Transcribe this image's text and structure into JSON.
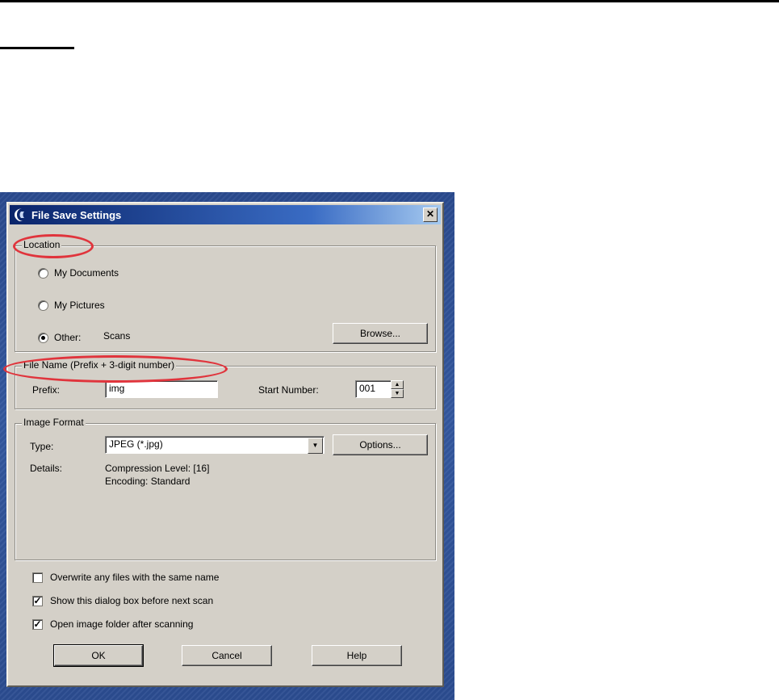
{
  "dialog": {
    "title": "File Save Settings",
    "close_glyph": "✕",
    "icons": [
      "app-icon",
      "close-icon"
    ]
  },
  "location": {
    "legend": "Location",
    "options": [
      {
        "label": "My Documents",
        "selected": false
      },
      {
        "label": "My Pictures",
        "selected": false
      },
      {
        "label": "Other:",
        "selected": true
      }
    ],
    "other_path": "Scans",
    "browse_label": "Browse..."
  },
  "file_name": {
    "legend": "File Name (Prefix + 3-digit number)",
    "prefix_label": "Prefix:",
    "prefix_value": "img",
    "start_label": "Start Number:",
    "start_value": "001"
  },
  "image_format": {
    "legend": "Image Format",
    "type_label": "Type:",
    "type_value": "JPEG (*.jpg)",
    "options_label": "Options...",
    "details_label": "Details:",
    "details_line1": "Compression Level: [16]",
    "details_line2": "Encoding: Standard"
  },
  "checkboxes": [
    {
      "label": "Overwrite any files with the same name",
      "checked": false
    },
    {
      "label": "Show this dialog box before next scan",
      "checked": true
    },
    {
      "label": "Open image folder after scanning",
      "checked": true
    }
  ],
  "buttons": {
    "ok": "OK",
    "cancel": "Cancel",
    "help": "Help"
  },
  "colors": {
    "annotation": "#e0343c",
    "titlebar": "#0a246a",
    "desktop": "#2a4a8e"
  }
}
